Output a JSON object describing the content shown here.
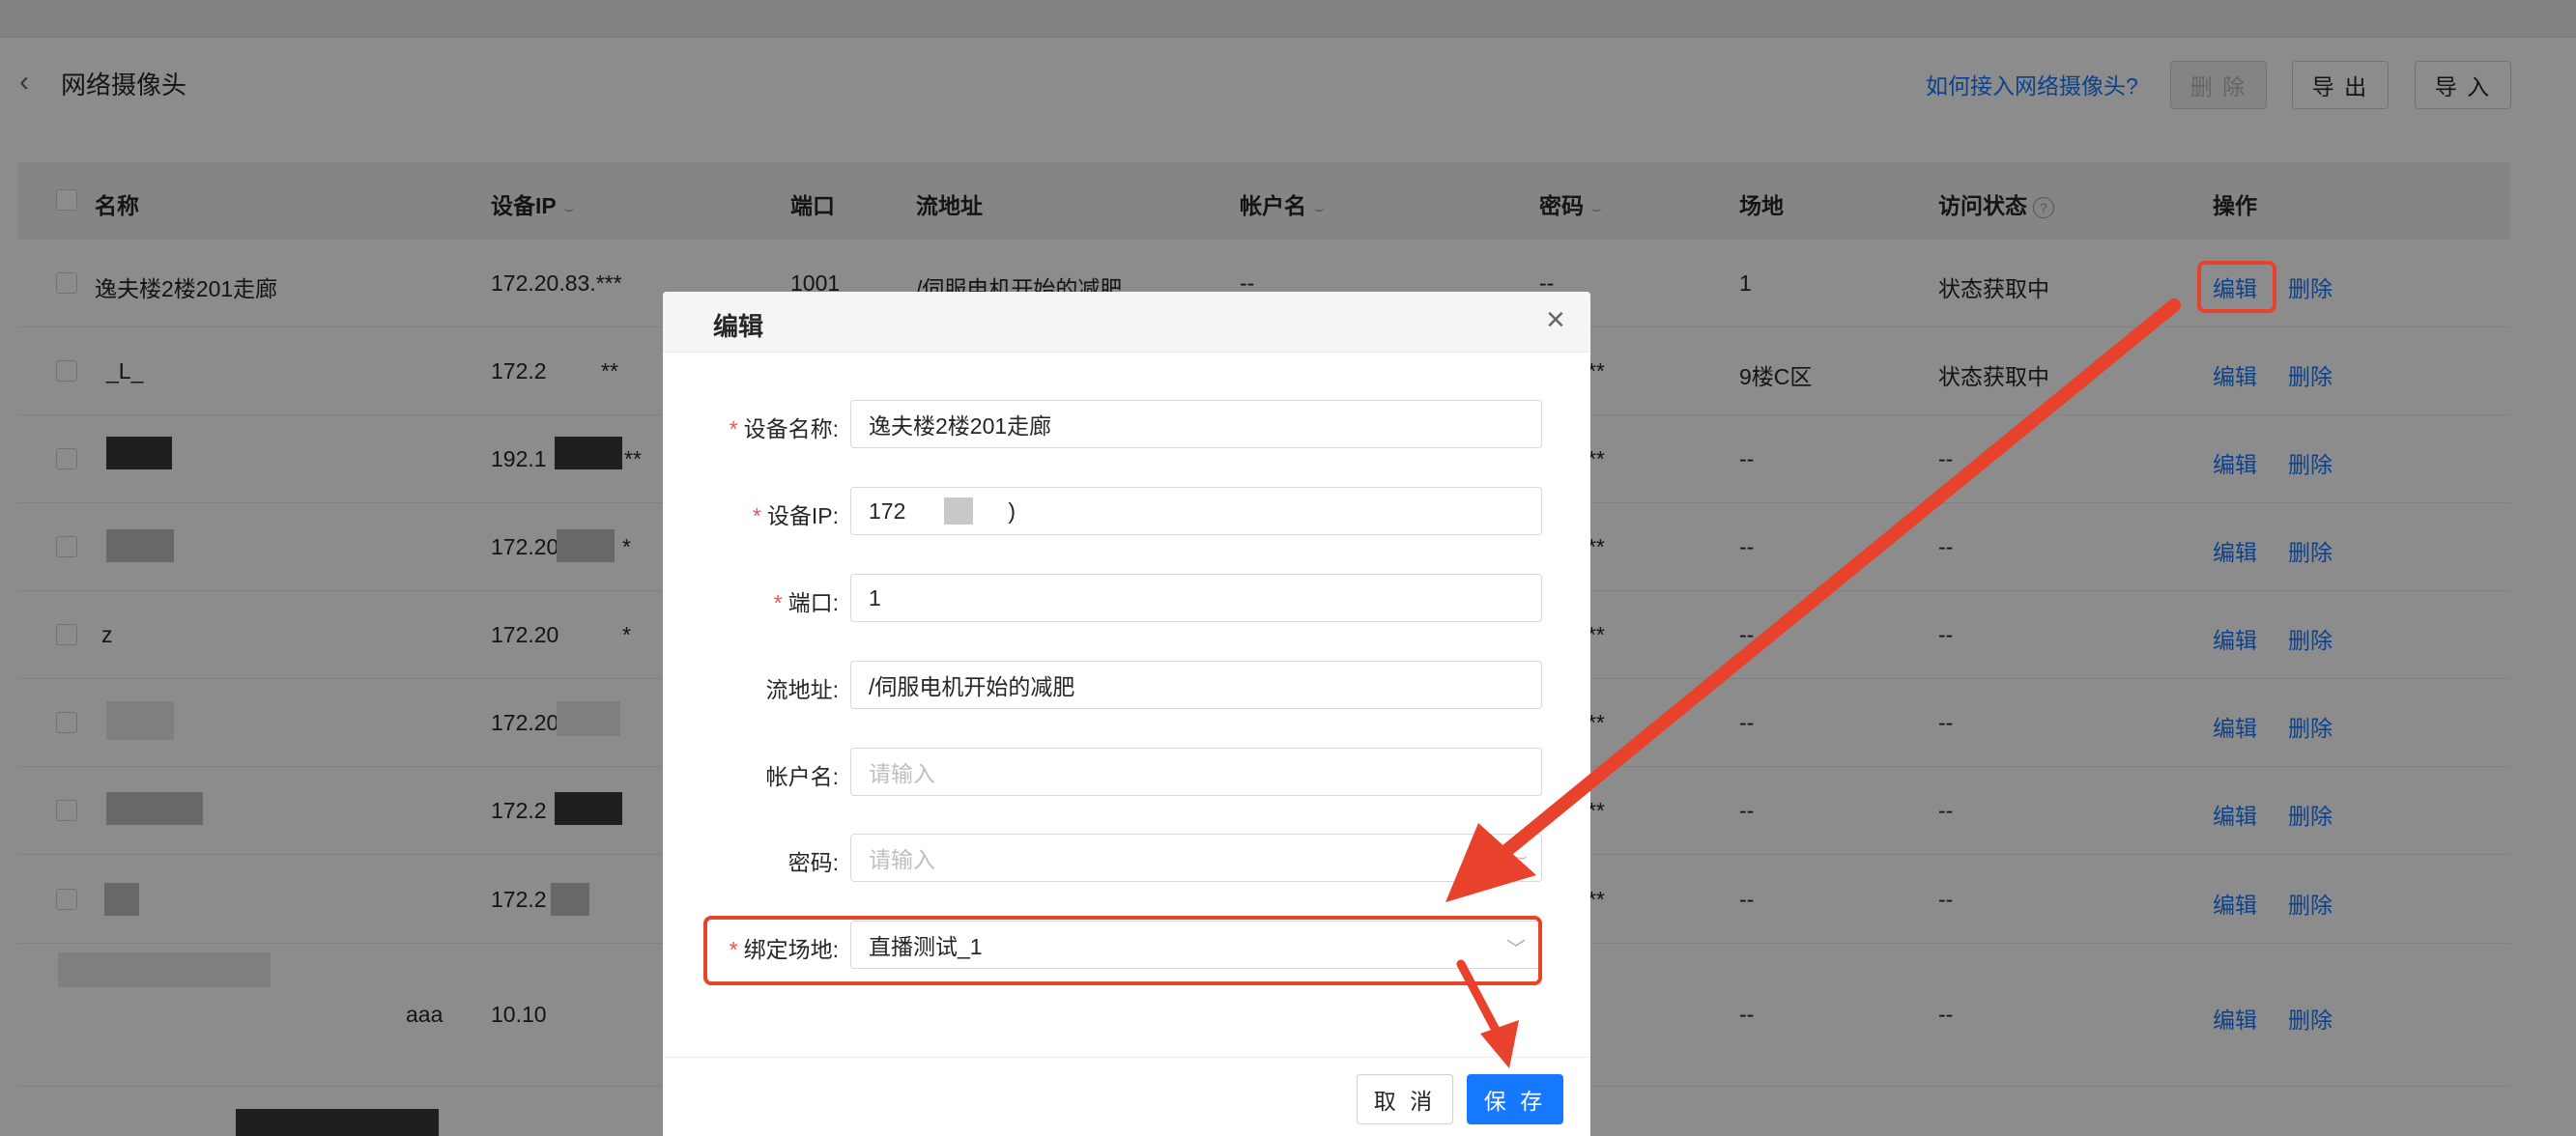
{
  "header": {
    "title": "网络摄像头",
    "help_link": "如何接入网络摄像头?",
    "delete_label": "删 除",
    "export_label": "导 出",
    "import_label": "导 入"
  },
  "table": {
    "columns": [
      "名称",
      "设备IP",
      "端口",
      "流地址",
      "帐户名",
      "密码",
      "场地",
      "访问状态",
      "操作"
    ],
    "action_edit": "编辑",
    "action_delete": "删除",
    "rows": [
      {
        "name": "逸夫楼2楼201走廊",
        "ip": "172.20.83.***",
        "port": "1001",
        "stream": "/伺服电机开始的减肥",
        "account": "--",
        "password": "--",
        "venue": "1",
        "status": "状态获取中"
      },
      {
        "name": "_L_",
        "ip": "172.2",
        "ip_tail": "**",
        "port": "",
        "stream": "",
        "account": "",
        "password": "****",
        "venue": "9楼C区",
        "status": "状态获取中"
      },
      {
        "name": "",
        "ip": "192.1",
        "ip_tail": "**",
        "port": "",
        "stream": "",
        "account": "",
        "password": "****",
        "venue": "--",
        "status": "--"
      },
      {
        "name": "",
        "ip": "172.20",
        "ip_tail": "*",
        "port": "",
        "stream": "",
        "account": "",
        "password": "****",
        "venue": "--",
        "status": "--"
      },
      {
        "name": "z",
        "ip": "172.20",
        "ip_tail": "*",
        "port": "",
        "stream": "",
        "account": "",
        "password": "****",
        "venue": "--",
        "status": "--"
      },
      {
        "name": "",
        "ip": "172.20",
        "ip_tail": "",
        "port": "",
        "stream": "",
        "account": "",
        "password": "****",
        "venue": "--",
        "status": "--"
      },
      {
        "name": "",
        "ip": "172.2",
        "ip_tail": "",
        "port": "",
        "stream": "",
        "account": "",
        "password": "****",
        "venue": "--",
        "status": "--"
      },
      {
        "name": "",
        "ip": "172.2",
        "ip_tail": "",
        "port": "",
        "stream": "",
        "account": "",
        "password": "****",
        "venue": "--",
        "status": "--"
      },
      {
        "name": "aaa",
        "ip": "10.10",
        "ip_tail": "",
        "port": "",
        "stream": "",
        "account": "",
        "password": "",
        "venue": "--",
        "status": "--"
      }
    ]
  },
  "modal": {
    "title": "编辑",
    "fields": {
      "device_name": {
        "label": "设备名称:",
        "value": "逸夫楼2楼201走廊",
        "required": true
      },
      "device_ip": {
        "label": "设备IP:",
        "value": "172",
        "tail": ")",
        "required": true
      },
      "port": {
        "label": "端口:",
        "value": "1",
        "required": true
      },
      "stream": {
        "label": "流地址:",
        "value": "/伺服电机开始的减肥",
        "required": false
      },
      "account": {
        "label": "帐户名:",
        "placeholder": "请输入",
        "required": false
      },
      "password": {
        "label": "密码:",
        "placeholder": "请输入",
        "required": false
      },
      "venue": {
        "label": "绑定场地:",
        "value": "直播测试_1",
        "required": true
      }
    },
    "cancel_label": "取 消",
    "save_label": "保 存"
  },
  "colors": {
    "primary": "#1677ff",
    "annotation": "#e8412c",
    "required": "#ff4d4f"
  },
  "icons": [
    "chevron-left-icon",
    "eye-off-icon",
    "question-icon",
    "close-icon",
    "chevron-down-icon"
  ]
}
